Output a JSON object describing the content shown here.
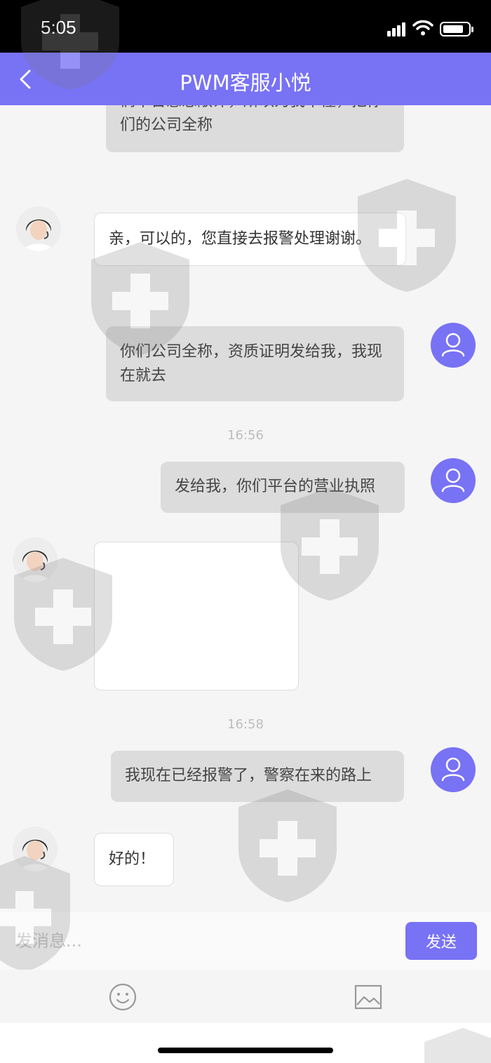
{
  "status_bar": {
    "time": "5:05"
  },
  "header": {
    "title": "PWM客服小悦"
  },
  "chat": {
    "messages": [
      {
        "from": "user",
        "text": "们平台感恩敞评，所以为我不懂，把你们的公司全称"
      },
      {
        "from": "agent",
        "text": "亲，可以的，您直接去报警处理谢谢。"
      },
      {
        "from": "user",
        "text": "你们公司全称，资质证明发给我，我现在就去"
      },
      {
        "from": "user",
        "text": "发给我，你们平台的营业执照"
      },
      {
        "from": "user",
        "text": "我现在已经报警了，警察在来的路上"
      },
      {
        "from": "agent",
        "text": "好的！"
      }
    ],
    "timestamps": [
      "16:56",
      "16:58"
    ]
  },
  "composer": {
    "placeholder": "发消息...",
    "send_label": "发送"
  },
  "toolbar": {
    "emoji_icon": "emoji-icon",
    "image_icon": "image-icon"
  },
  "colors": {
    "accent": "#7872f5",
    "user_bubble": "#dcdcdc",
    "background": "#f5f5f5"
  }
}
